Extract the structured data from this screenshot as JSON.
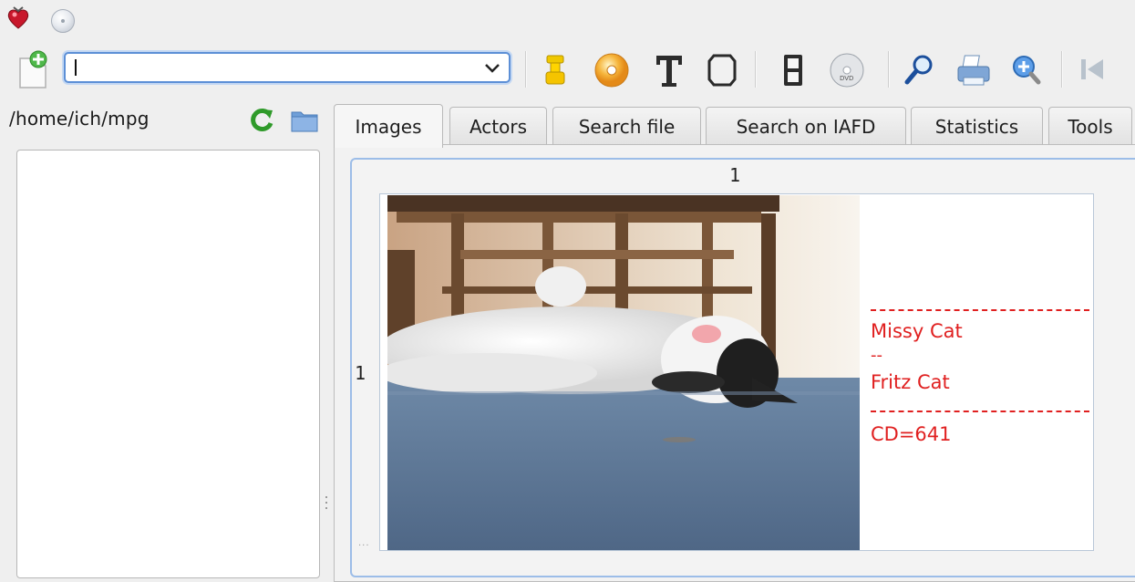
{
  "toolbar": {
    "path_input_value": "",
    "buttons": [
      {
        "icon": "add-document-icon"
      },
      {
        "icon": "actor-figure-icon"
      },
      {
        "icon": "cd-disc-icon"
      },
      {
        "icon": "text-T-icon"
      },
      {
        "icon": "frame-icon"
      },
      {
        "icon": "film-strip-icon"
      },
      {
        "icon": "dvd-disc-icon"
      },
      {
        "icon": "search-magnifier-icon"
      },
      {
        "icon": "printer-icon"
      },
      {
        "icon": "zoom-in-icon"
      },
      {
        "icon": "first-page-icon"
      }
    ]
  },
  "left_panel": {
    "directory": "/home/ich/mpg"
  },
  "tabs": [
    {
      "label": "Images",
      "active": true
    },
    {
      "label": "Actors"
    },
    {
      "label": "Search file"
    },
    {
      "label": "Search on IAFD"
    },
    {
      "label": "Statistics"
    },
    {
      "label": "Tools"
    }
  ],
  "grid": {
    "column_header": "1",
    "row_header": "1",
    "corner": "...",
    "cell": {
      "separator": "------------------------------",
      "actor_1": "Missy Cat",
      "actor_separator": "--",
      "actor_2": "Fritz Cat",
      "cd": "CD=641"
    }
  },
  "colors": {
    "accent": "#5c8fd6",
    "cell_text": "#e02020"
  }
}
